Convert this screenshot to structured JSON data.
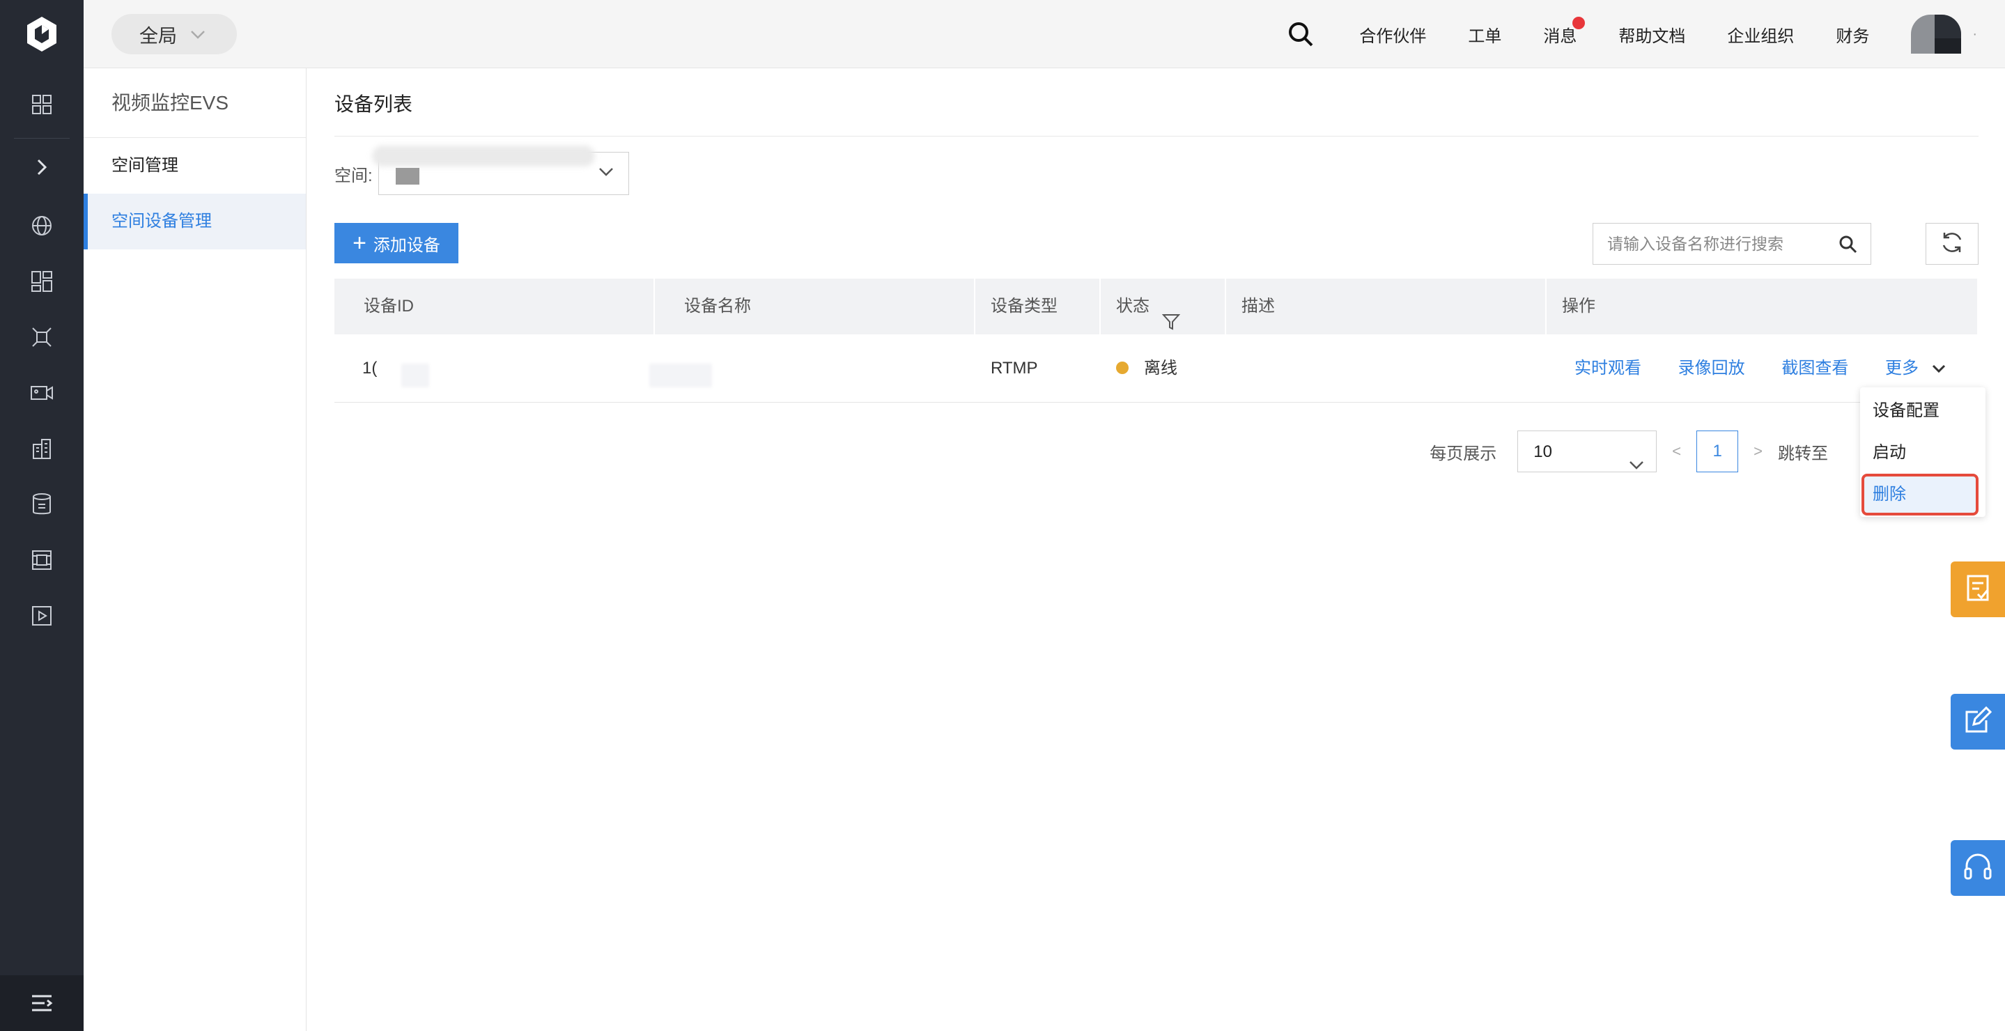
{
  "topbar": {
    "scope_label": "全局",
    "nav": [
      "合作伙伴",
      "工单",
      "消息",
      "帮助文档",
      "企业组织",
      "财务"
    ],
    "avatar_suffix": "·"
  },
  "sidebar": {
    "product_title": "视频监控EVS",
    "group_label": "空间管理",
    "active_item": "空间设备管理"
  },
  "main": {
    "page_title": "设备列表",
    "space_label": "空间:",
    "add_button": "添加设备",
    "search_placeholder": "请输入设备名称进行搜索",
    "table": {
      "headers": [
        "设备ID",
        "设备名称",
        "设备类型",
        "状态",
        "描述",
        "操作"
      ],
      "rows": [
        {
          "id": "1(",
          "name": "",
          "type": "RTMP",
          "status": "离线",
          "description": "",
          "actions": [
            "实时观看",
            "录像回放",
            "截图查看",
            "更多"
          ]
        }
      ]
    },
    "pagination": {
      "page_size_label": "每页展示",
      "page_size": "10",
      "prev": "<",
      "current_page": "1",
      "next": ">",
      "jump_label": "跳转至"
    }
  },
  "more_menu": [
    "设备配置",
    "启动",
    "删除"
  ],
  "colors": {
    "accent": "#3a87e0",
    "status_offline": "#e6a930",
    "highlight_border": "#e54b3c",
    "rail": "#262a33"
  }
}
